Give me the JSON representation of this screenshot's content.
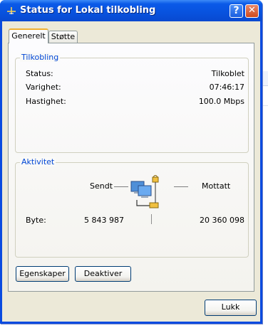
{
  "window": {
    "title": "Status for Lokal tilkobling"
  },
  "tabs": [
    {
      "label": "Generelt",
      "active": true
    },
    {
      "label": "Støtte",
      "active": false
    }
  ],
  "connection": {
    "group_title": "Tilkobling",
    "rows": [
      {
        "label": "Status:",
        "value": "Tilkoblet"
      },
      {
        "label": "Varighet:",
        "value": "07:46:17"
      },
      {
        "label": "Hastighet:",
        "value": "100.0 Mbps"
      }
    ]
  },
  "activity": {
    "group_title": "Aktivitet",
    "sent_label": "Sendt",
    "received_label": "Mottatt",
    "bytes_label": "Byte:",
    "bytes_sent": "5 843 987",
    "bytes_received": "20 360 098"
  },
  "buttons": {
    "properties": "Egenskaper",
    "disable": "Deaktiver",
    "close": "Lukk"
  },
  "icons": [
    "network-connection-icon",
    "help-icon",
    "close-icon",
    "network-activity-icon"
  ],
  "colors": {
    "titlebar": "#0a5ae8",
    "dialog_bg": "#ece9d8",
    "group_title": "#0046d5",
    "tab_highlight": "#f0b030"
  }
}
